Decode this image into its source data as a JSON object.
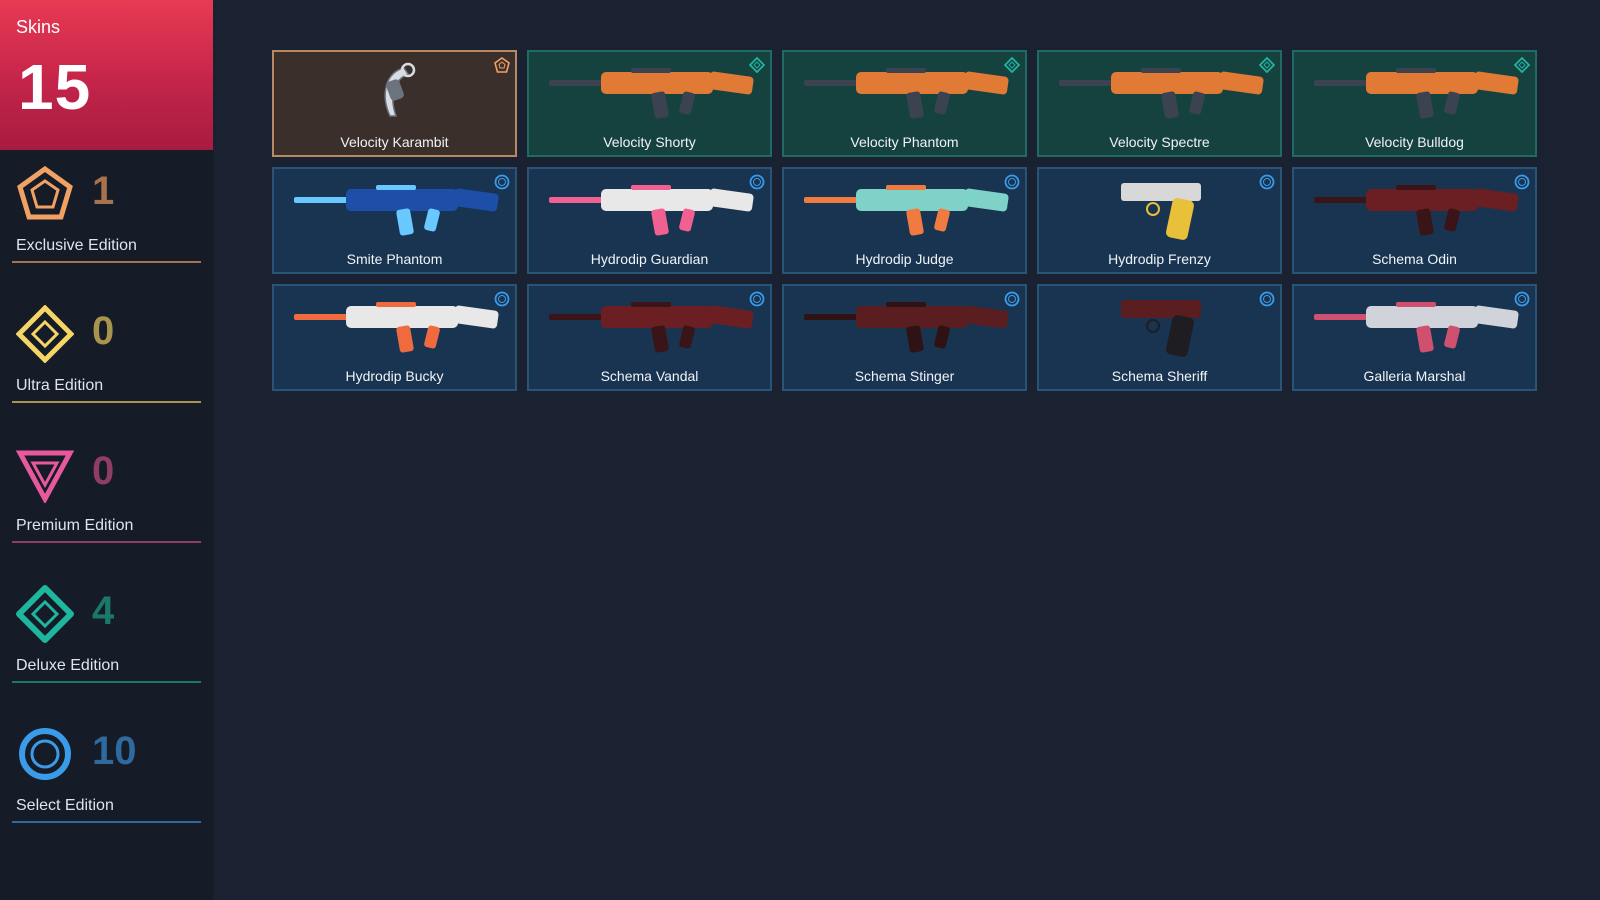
{
  "sidebar": {
    "total_label": "Skins",
    "total_count": "15",
    "tiers": [
      {
        "name": "Exclusive Edition",
        "count": "1",
        "color": "#f2a165",
        "count_color": "#a8724f",
        "icon": "exclusive-pentagon-icon"
      },
      {
        "name": "Ultra Edition",
        "count": "0",
        "color": "#f5d565",
        "count_color": "#a8944d",
        "icon": "ultra-diamond-icon"
      },
      {
        "name": "Premium Edition",
        "count": "0",
        "color": "#e7599c",
        "count_color": "#8e3e63",
        "icon": "premium-triangle-icon"
      },
      {
        "name": "Deluxe Edition",
        "count": "4",
        "color": "#1fb59f",
        "count_color": "#1a7869",
        "icon": "deluxe-diamond-icon"
      },
      {
        "name": "Select Edition",
        "count": "10",
        "color": "#3a9ce8",
        "count_color": "#2f6a9e",
        "icon": "select-circle-icon"
      }
    ]
  },
  "skins": [
    {
      "name": "Velocity Karambit",
      "tier": "exclusive",
      "palette": [
        "#d8dde3",
        "#6b737e"
      ]
    },
    {
      "name": "Velocity Shorty",
      "tier": "deluxe",
      "palette": [
        "#e07a35",
        "#3c4350"
      ]
    },
    {
      "name": "Velocity Phantom",
      "tier": "deluxe",
      "palette": [
        "#e07a35",
        "#3c4350"
      ]
    },
    {
      "name": "Velocity Spectre",
      "tier": "deluxe",
      "palette": [
        "#e07a35",
        "#3c4350"
      ]
    },
    {
      "name": "Velocity Bulldog",
      "tier": "deluxe",
      "palette": [
        "#e07a35",
        "#3c4350"
      ]
    },
    {
      "name": "Smite Phantom",
      "tier": "select",
      "palette": [
        "#1e4fa8",
        "#69c8ff"
      ]
    },
    {
      "name": "Hydrodip Guardian",
      "tier": "select",
      "palette": [
        "#e8e8e8",
        "#f06090"
      ]
    },
    {
      "name": "Hydrodip Judge",
      "tier": "select",
      "palette": [
        "#7ed2c8",
        "#f07a40"
      ]
    },
    {
      "name": "Hydrodip Frenzy",
      "tier": "select",
      "palette": [
        "#d8d8d8",
        "#e8c03a"
      ]
    },
    {
      "name": "Schema Odin",
      "tier": "select",
      "palette": [
        "#6b1f22",
        "#3a1416"
      ]
    },
    {
      "name": "Hydrodip Bucky",
      "tier": "select",
      "palette": [
        "#e8e8e8",
        "#f06a40"
      ]
    },
    {
      "name": "Schema Vandal",
      "tier": "select",
      "palette": [
        "#6b1f22",
        "#3a1416"
      ]
    },
    {
      "name": "Schema Stinger",
      "tier": "select",
      "palette": [
        "#5a1d20",
        "#2e1214"
      ]
    },
    {
      "name": "Schema Sheriff",
      "tier": "select",
      "palette": [
        "#5a1d20",
        "#1e1d22"
      ]
    },
    {
      "name": "Galleria Marshal",
      "tier": "select",
      "palette": [
        "#d0d4da",
        "#d05070"
      ]
    }
  ]
}
